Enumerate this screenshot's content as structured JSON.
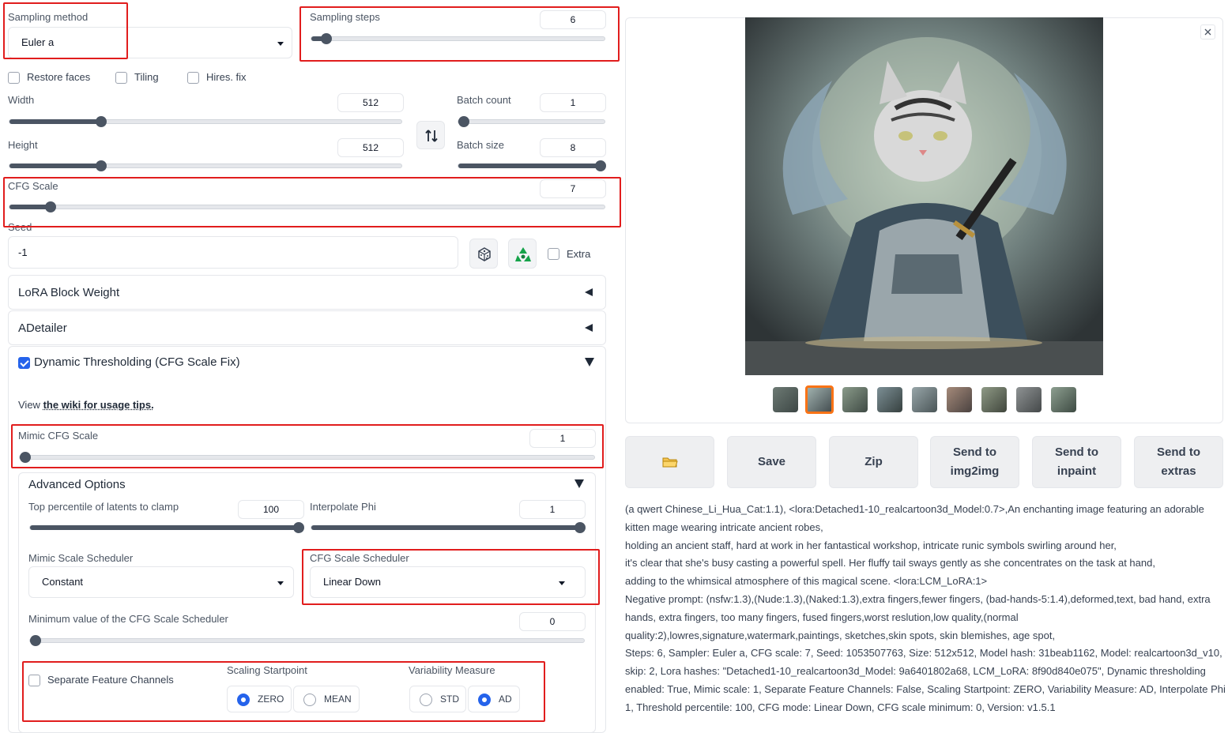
{
  "sampling": {
    "method_label": "Sampling method",
    "method_value": "Euler a",
    "steps_label": "Sampling steps",
    "steps_value": "6"
  },
  "checkboxes": {
    "restore_faces": "Restore faces",
    "tiling": "Tiling",
    "hires_fix": "Hires. fix"
  },
  "size": {
    "width_label": "Width",
    "width_value": "512",
    "height_label": "Height",
    "height_value": "512",
    "batch_count_label": "Batch count",
    "batch_count_value": "1",
    "batch_size_label": "Batch size",
    "batch_size_value": "8",
    "swap_icon": "swap-vertical-icon"
  },
  "cfg": {
    "label": "CFG Scale",
    "value": "7"
  },
  "seed": {
    "label": "Seed",
    "value": "-1",
    "extra_label": "Extra",
    "dice_icon": "dice-icon",
    "recycle_icon": "recycle-icon"
  },
  "accordions": {
    "lora_block_weight": "LoRA Block Weight",
    "adetailer": "ADetailer",
    "dynamic_thresholding": "Dynamic Thresholding (CFG Scale Fix)"
  },
  "dyn": {
    "view_text": "View ",
    "wiki_link": "the wiki for usage tips.",
    "mimic_label": "Mimic CFG Scale",
    "mimic_value": "1",
    "advanced_title": "Advanced Options",
    "top_percentile_label": "Top percentile of latents to clamp",
    "top_percentile_value": "100",
    "interpolate_phi_label": "Interpolate Phi",
    "interpolate_phi_value": "1",
    "mimic_scheduler_label": "Mimic Scale Scheduler",
    "mimic_scheduler_value": "Constant",
    "cfg_scheduler_label": "CFG Scale Scheduler",
    "cfg_scheduler_value": "Linear Down",
    "min_value_label": "Minimum value of the CFG Scale Scheduler",
    "min_value_value": "0",
    "separate_channels_label": "Separate Feature Channels",
    "scaling_startpoint_label": "Scaling Startpoint",
    "zero_label": "ZERO",
    "mean_label": "MEAN",
    "variability_label": "Variability Measure",
    "std_label": "STD",
    "ad_label": "AD"
  },
  "output": {
    "close_icon": "close-icon",
    "folder_icon": "folder-icon",
    "save": "Save",
    "zip": "Zip",
    "send_img2img_1": "Send to",
    "send_img2img_2": "img2img",
    "send_inpaint_1": "Send to",
    "send_inpaint_2": "inpaint",
    "send_extras_1": "Send to",
    "send_extras_2": "extras",
    "info_lines": [
      "(a qwert Chinese_Li_Hua_Cat:1.1), <lora:Detached1-10_realcartoon3d_Model:0.7>,An enchanting image featuring an adorable",
      "kitten mage wearing intricate ancient robes,",
      "holding an ancient staff, hard at work in her fantastical workshop, intricate runic symbols swirling around her,",
      "it's clear that she's busy casting a powerful spell. Her fluffy tail sways gently as she concentrates on the task at hand,",
      "adding to the whimsical atmosphere of this magical scene. <lora:LCM_LoRA:1>",
      "Negative prompt: (nsfw:1.3),(Nude:1.3),(Naked:1.3),extra fingers,fewer fingers, (bad-hands-5:1.4),deformed,text, bad hand, extra",
      "hands, extra fingers, too many fingers, fused fingers,worst reslution,low quality,(normal",
      "quality:2),lowres,signature,watermark,paintings, sketches,skin spots, skin blemishes, age spot,",
      "Steps: 6, Sampler: Euler a, CFG scale: 7, Seed: 1053507763, Size: 512x512, Model hash: 31beab1162, Model: realcartoon3d_v10, Clip",
      "skip: 2, Lora hashes: \"Detached1-10_realcartoon3d_Model: 9a6401802a68, LCM_LoRA: 8f90d840e075\", Dynamic thresholding",
      "enabled: True, Mimic scale: 1, Separate Feature Channels: False, Scaling Startpoint: ZERO, Variability Measure: AD, Interpolate Phi:",
      "1, Threshold percentile: 100, CFG mode: Linear Down, CFG scale minimum: 0, Version: v1.5.1"
    ]
  },
  "colors": {
    "accent": "#2563eb",
    "highlight": "#e11d1d",
    "slider": "#4b5563"
  }
}
